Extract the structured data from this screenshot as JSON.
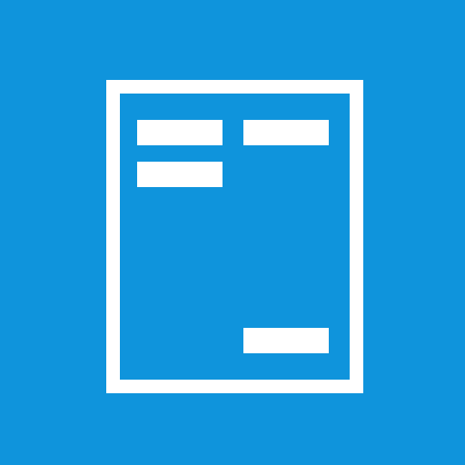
{
  "icon": {
    "name": "document-form-icon",
    "background_color": "#0f94dc",
    "foreground_color": "#ffffff"
  }
}
